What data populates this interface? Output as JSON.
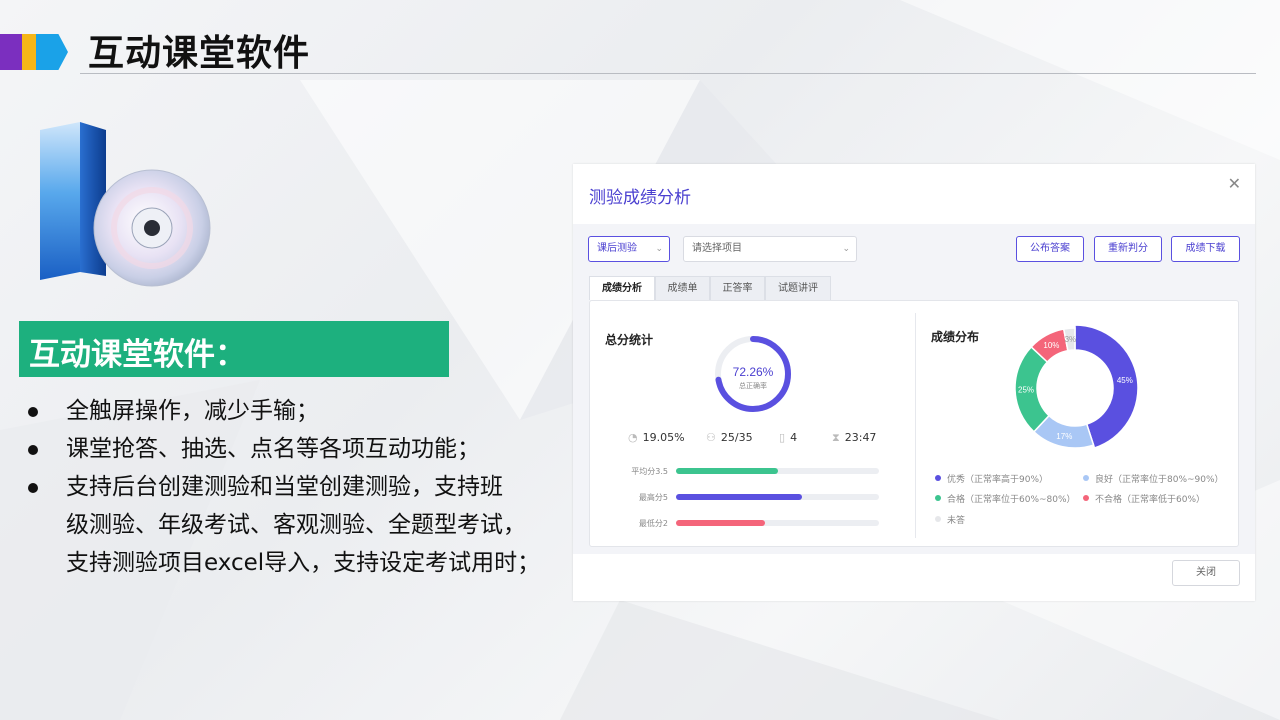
{
  "header": {
    "title": "互动课堂软件"
  },
  "section": {
    "heading": "互动课堂软件：",
    "bullets": [
      "全触屏操作，减少手输；",
      "课堂抢答、抽选、点名等各项互动功能；",
      "支持后台创建测验和当堂创建测验，支持班",
      "级测验、年级考试、客观测验、全题型考试，",
      "支持测验项目excel导入，支持设定考试用时；"
    ]
  },
  "dialog": {
    "title": "测验成绩分析",
    "close_icon": "close-icon",
    "type_select": "课后测验",
    "item_select_placeholder": "请选择项目",
    "buttons": {
      "publish": "公布答案",
      "rejudge": "重新判分",
      "download": "成绩下载",
      "close": "关闭"
    },
    "tabs": [
      "成绩分析",
      "成绩单",
      "正答率",
      "试题讲评"
    ],
    "active_tab": "成绩分析",
    "total": {
      "title": "总分统计",
      "rate_value": "72.26%",
      "rate_fraction": 0.7226,
      "rate_label": "总正确率",
      "stats": [
        {
          "icon": "pie-icon",
          "value": "19.05%"
        },
        {
          "icon": "person-icon",
          "value": "25/35"
        },
        {
          "icon": "document-icon",
          "value": "4"
        },
        {
          "icon": "hourglass-icon",
          "value": "23:47"
        }
      ],
      "bars": [
        {
          "label": "平均分3.5",
          "fraction": 0.5,
          "color": "#3cc48f"
        },
        {
          "label": "最高分5",
          "fraction": 0.62,
          "color": "#5a50e0"
        },
        {
          "label": "最低分2",
          "fraction": 0.44,
          "color": "#f4657a"
        }
      ]
    },
    "distribution": {
      "title": "成绩分布",
      "legend": [
        {
          "label": "优秀（正常率高于90%）",
          "color": "#5a50e0"
        },
        {
          "label": "良好（正常率位于80%~90%）",
          "color": "#a9c7f5"
        },
        {
          "label": "合格（正常率位于60%~80%）",
          "color": "#3cc48f"
        },
        {
          "label": "不合格（正常率低于60%）",
          "color": "#f4657a"
        },
        {
          "label": "未答",
          "color": "#e6e7ea"
        }
      ]
    }
  },
  "chart_data": {
    "type": "pie",
    "title": "成绩分布",
    "categories": [
      "优秀",
      "良好",
      "合格",
      "不合格",
      "未答"
    ],
    "values": [
      45,
      17,
      25,
      10,
      3
    ],
    "labels": [
      "45%",
      "17%",
      "25%",
      "10%",
      "3%"
    ],
    "colors": [
      "#5a50e0",
      "#a9c7f5",
      "#3cc48f",
      "#f4657a",
      "#e6e7ea"
    ]
  }
}
